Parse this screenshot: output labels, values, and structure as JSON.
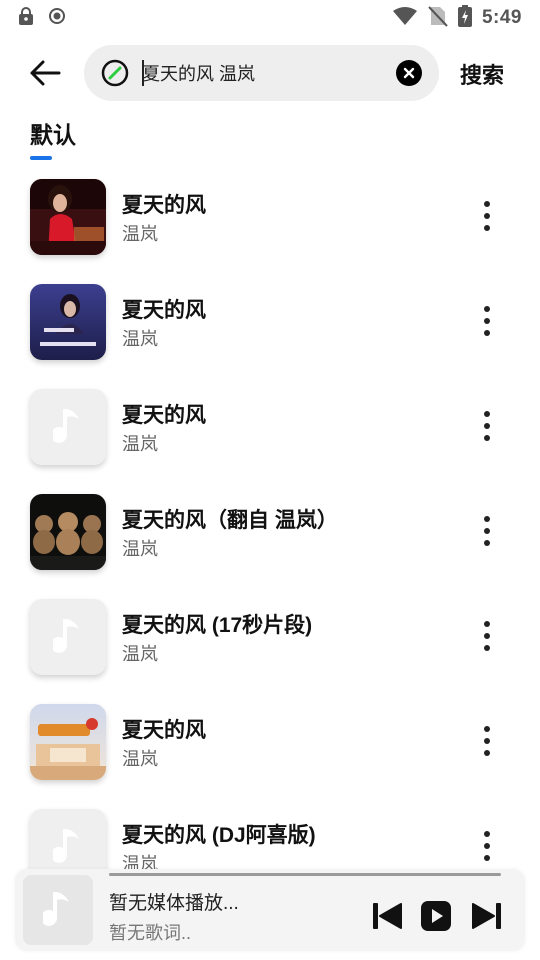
{
  "status_bar": {
    "time": "5:49",
    "icons": [
      "lock-icon",
      "record-icon",
      "wifi-icon",
      "no-sim-icon",
      "battery-charging-icon"
    ]
  },
  "header": {
    "back_icon": "arrow-left-icon",
    "link_icon": "link-icon",
    "search_value": "夏天的风 温岚",
    "clear_icon": "close-circle-icon",
    "search_button": "搜索"
  },
  "tabs": [
    {
      "label": "默认",
      "active": true
    }
  ],
  "colors": {
    "accent": "#1a73e8",
    "search_bg": "#eeeeee",
    "player_bg": "#f4f4f4"
  },
  "songs": [
    {
      "title": "夏天的风",
      "artist": "温岚",
      "cover": "red-dress-photo"
    },
    {
      "title": "夏天的风",
      "artist": "温岚",
      "cover": "concert-poster"
    },
    {
      "title": "夏天的风",
      "artist": "温岚",
      "cover": "placeholder-note"
    },
    {
      "title": "夏天的风（翻自 温岚）",
      "artist": "温岚",
      "cover": "teddy-bears-photo"
    },
    {
      "title": "夏天的风 (17秒片段)",
      "artist": "温岚",
      "cover": "placeholder-note"
    },
    {
      "title": "夏天的风",
      "artist": "温岚",
      "cover": "stage-show-poster"
    },
    {
      "title": "夏天的风 (DJ阿喜版)",
      "artist": "温岚",
      "cover": "placeholder-note"
    }
  ],
  "mini_player": {
    "title": "暂无媒体播放...",
    "subtitle": "暂无歌词..",
    "controls": [
      "previous-icon",
      "play-icon",
      "next-icon"
    ]
  }
}
